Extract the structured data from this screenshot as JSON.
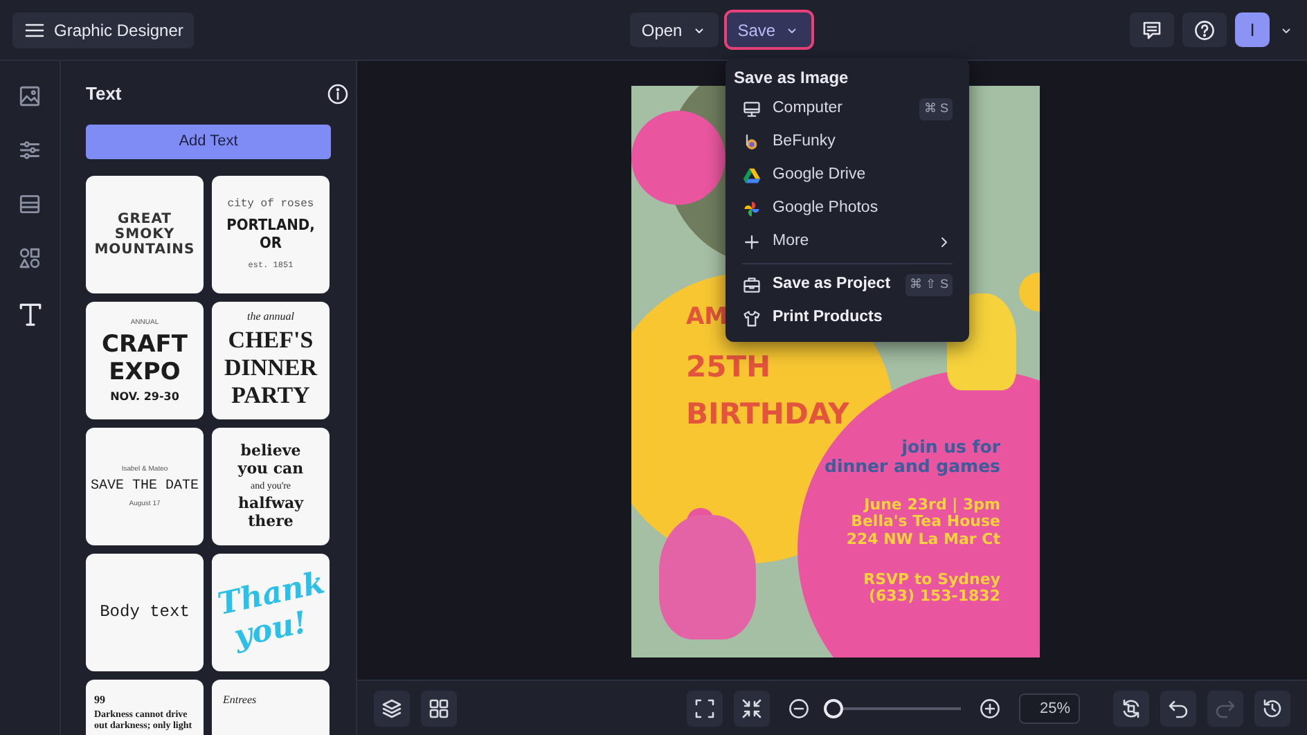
{
  "topbar": {
    "menu_title": "Graphic Designer",
    "open_label": "Open",
    "save_label": "Save",
    "save_highlighted": true,
    "avatar_initial": "I"
  },
  "rail": [
    {
      "selected": false
    },
    {
      "selected": false
    },
    {
      "selected": false
    },
    {
      "selected": false
    },
    {
      "selected": true
    }
  ],
  "panel": {
    "title": "Text",
    "add_button": "Add Text",
    "tiles": [
      {
        "kind": "heavy",
        "lines": [
          "GREAT",
          "SMOKY",
          "MOUNTAINS"
        ]
      },
      {
        "kind": "arch",
        "lines": [
          "city of roses",
          "PORTLAND, OR",
          "est. 1851"
        ]
      },
      {
        "kind": "craft",
        "lines": [
          "ANNUAL",
          "CRAFT",
          "EXPO",
          "NOV. 29-30"
        ]
      },
      {
        "kind": "chef",
        "lines": [
          "the annual",
          "CHEF'S",
          "DINNER",
          "PARTY"
        ]
      },
      {
        "kind": "date",
        "lines": [
          "Isabel & Mateo",
          "SAVE THE DATE",
          "August 17"
        ]
      },
      {
        "kind": "quote",
        "lines": [
          "believe",
          "you can",
          "and you're",
          "halfway",
          "there"
        ]
      },
      {
        "kind": "mono",
        "lines": [
          "Body text"
        ]
      },
      {
        "kind": "script",
        "lines": [
          "Thank",
          "you!"
        ]
      },
      {
        "kind": "darkness",
        "lines": [
          "99",
          "Darkness cannot drive",
          "out darkness; only light"
        ]
      },
      {
        "kind": "menu",
        "lines": [
          "Entrees"
        ]
      }
    ]
  },
  "save_menu": {
    "heading": "Save as Image",
    "items": [
      {
        "kind": "computer",
        "label": "Computer",
        "shortcut": "⌘ S"
      },
      {
        "kind": "befunky",
        "label": "BeFunky"
      },
      {
        "kind": "drive",
        "label": "Google Drive"
      },
      {
        "kind": "photos",
        "label": "Google Photos"
      },
      {
        "kind": "more",
        "label": "More"
      },
      {
        "kind": "project",
        "label": "Save as Project",
        "shortcut": "⌘ ⇧ S"
      },
      {
        "kind": "print",
        "label": "Print Products"
      }
    ]
  },
  "poster": {
    "title_lines": [
      "AM",
      "25TH",
      "BIRTHDAY"
    ],
    "invite_lines": [
      "join us for",
      "dinner and games"
    ],
    "detail_lines": [
      "June 23rd | 3pm",
      "Bella's Tea House",
      "224 NW La Mar Ct"
    ],
    "rsvp_lines": [
      "RSVP to Sydney",
      "(633) 153-1832"
    ]
  },
  "bottombar": {
    "zoom": {
      "level": 0.04,
      "reading": "25%"
    },
    "tools": [
      {
        "disabled": false
      },
      {
        "disabled": false
      },
      {
        "disabled": true
      },
      {
        "disabled": false
      }
    ]
  }
}
